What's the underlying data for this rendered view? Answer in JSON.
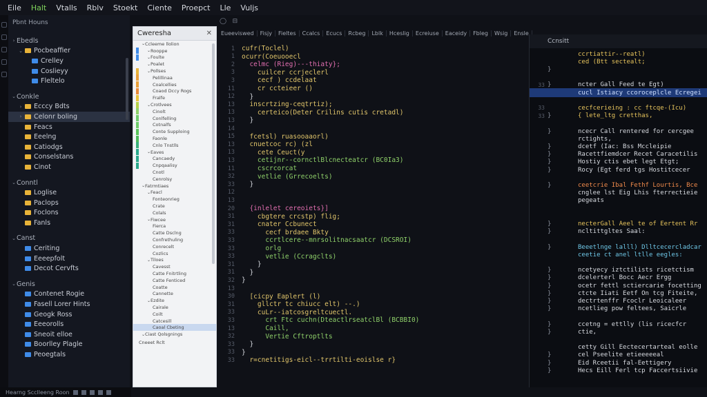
{
  "menu": [
    "Eile",
    "Halt",
    "Vtalls",
    "Rblv",
    "Stoekt",
    "Ciente",
    "Proepct",
    "Lle",
    "Vuljs"
  ],
  "sidebar": {
    "title": "Pbnt Houns",
    "rows": [
      {
        "text": "Ebedls",
        "depth": 0,
        "chev": "›",
        "icon": "none",
        "section": true
      },
      {
        "text": "Pocbeaffier",
        "depth": 1,
        "chev": "⌄",
        "icon": "folder"
      },
      {
        "text": "Crelley",
        "depth": 2,
        "chev": "",
        "icon": "folder-blue"
      },
      {
        "text": "Coslieyy",
        "depth": 2,
        "chev": "",
        "icon": "folder-blue"
      },
      {
        "text": "Fleltelo",
        "depth": 2,
        "chev": "",
        "icon": "folder-blue"
      },
      {
        "text": "Conkle",
        "depth": 0,
        "chev": "⌄",
        "icon": "none",
        "section": true
      },
      {
        "text": "Ecccy Bdts",
        "depth": 1,
        "chev": "›",
        "icon": "folder"
      },
      {
        "text": "Celonr boling",
        "depth": 1,
        "chev": "›",
        "icon": "folder",
        "selected": true
      },
      {
        "text": "Feacs",
        "depth": 1,
        "chev": "",
        "icon": "folder"
      },
      {
        "text": "Eeelng",
        "depth": 1,
        "chev": "",
        "icon": "folder"
      },
      {
        "text": "Catiodgs",
        "depth": 1,
        "chev": "",
        "icon": "folder"
      },
      {
        "text": "Conselstans",
        "depth": 1,
        "chev": "",
        "icon": "folder"
      },
      {
        "text": "Cinot",
        "depth": 1,
        "chev": "",
        "icon": "folder"
      },
      {
        "text": "Conntl",
        "depth": 0,
        "chev": "⌄",
        "icon": "none",
        "section": true
      },
      {
        "text": "Loglise",
        "depth": 1,
        "chev": "",
        "icon": "folder"
      },
      {
        "text": "Paclops",
        "depth": 1,
        "chev": "",
        "icon": "folder"
      },
      {
        "text": "Foclons",
        "depth": 1,
        "chev": "",
        "icon": "folder"
      },
      {
        "text": "Fanls",
        "depth": 1,
        "chev": "",
        "icon": "folder"
      },
      {
        "text": "Canst",
        "depth": 0,
        "chev": "⌄",
        "icon": "none",
        "section": true
      },
      {
        "text": "Ceriting",
        "depth": 1,
        "chev": "",
        "icon": "folder-blue"
      },
      {
        "text": "Eeeepfolt",
        "depth": 1,
        "chev": "",
        "icon": "folder-blue"
      },
      {
        "text": "Decot Cervfts",
        "depth": 1,
        "chev": "",
        "icon": "folder-blue"
      },
      {
        "text": "Genis",
        "depth": 0,
        "chev": "⌄",
        "icon": "none",
        "section": true
      },
      {
        "text": "Contenet Rogie",
        "depth": 1,
        "chev": "",
        "icon": "folder-blue"
      },
      {
        "text": "Fasell Lorer Hints",
        "depth": 1,
        "chev": "",
        "icon": "folder-blue"
      },
      {
        "text": "Geogk Ross",
        "depth": 1,
        "chev": "",
        "icon": "folder-blue"
      },
      {
        "text": "Eeeorolls",
        "depth": 1,
        "chev": "",
        "icon": "folder-blue"
      },
      {
        "text": "Sneoit elloe",
        "depth": 1,
        "chev": "",
        "icon": "folder-blue"
      },
      {
        "text": "Boorlley Plagle",
        "depth": 1,
        "chev": "",
        "icon": "folder-blue"
      },
      {
        "text": "Peoegtals",
        "depth": 1,
        "chev": "",
        "icon": "folder-blue"
      }
    ]
  },
  "status": {
    "text": "Hearng Scclleeng Roon"
  },
  "outline": {
    "title": "Cweresha",
    "close": "✕",
    "rows": [
      {
        "text": "Ccleeme llolion",
        "depth": 0,
        "mark": ""
      },
      {
        "text": "Rooppe",
        "depth": 1,
        "mark": "#3f8be8"
      },
      {
        "text": "Foulte",
        "depth": 1,
        "mark": "#3f8be8"
      },
      {
        "text": "Poalet",
        "depth": 1,
        "mark": ""
      },
      {
        "text": "Pollses",
        "depth": 1,
        "mark": "#e8b339"
      },
      {
        "text": "Pelillinaa",
        "depth": 2,
        "mark": "#e8a039"
      },
      {
        "text": "Coalcellies",
        "depth": 2,
        "mark": "#e8a039"
      },
      {
        "text": "Coaod Dccy Rogs",
        "depth": 2,
        "mark": "#e88a39"
      },
      {
        "text": "Fralfe",
        "depth": 2,
        "mark": "#e8c339"
      },
      {
        "text": "Crotlvees",
        "depth": 1,
        "mark": "#b6d14a"
      },
      {
        "text": "Cinolt",
        "depth": 2,
        "mark": "#8fd16a"
      },
      {
        "text": "Conlfelling",
        "depth": 2,
        "mark": "#6fcc6a"
      },
      {
        "text": "Cotnalfs",
        "depth": 2,
        "mark": "#6fcc6a"
      },
      {
        "text": "Conte Supploing",
        "depth": 2,
        "mark": "#5ac45a"
      },
      {
        "text": "Faonle",
        "depth": 2,
        "mark": "#4cba5a"
      },
      {
        "text": "Cnlo Tnstlls",
        "depth": 2,
        "mark": "#3ab07a"
      },
      {
        "text": "Eaves",
        "depth": 1,
        "mark": "#2aa88a"
      },
      {
        "text": "Cancaedy",
        "depth": 2,
        "mark": "#2aa88a"
      },
      {
        "text": "Cnpqaalisy",
        "depth": 2,
        "mark": "#2aa88a"
      },
      {
        "text": "Cnotl",
        "depth": 2,
        "mark": ""
      },
      {
        "text": "Cenrolsy",
        "depth": 2,
        "mark": ""
      },
      {
        "text": "Fatrmtiaes",
        "depth": 0,
        "mark": ""
      },
      {
        "text": "Feacl",
        "depth": 1,
        "mark": ""
      },
      {
        "text": "Fonteonrieg",
        "depth": 2,
        "mark": ""
      },
      {
        "text": "Crate",
        "depth": 2,
        "mark": ""
      },
      {
        "text": "Colals",
        "depth": 2,
        "mark": ""
      },
      {
        "text": "Fiwcee",
        "depth": 1,
        "mark": ""
      },
      {
        "text": "Fierca",
        "depth": 2,
        "mark": ""
      },
      {
        "text": "Catte Dsclng",
        "depth": 2,
        "mark": ""
      },
      {
        "text": "Confrethuling",
        "depth": 2,
        "mark": ""
      },
      {
        "text": "Conrecelt",
        "depth": 2,
        "mark": ""
      },
      {
        "text": "Cozlics",
        "depth": 2,
        "mark": ""
      },
      {
        "text": "Tiloes",
        "depth": 1,
        "mark": ""
      },
      {
        "text": "Cavesst",
        "depth": 2,
        "mark": ""
      },
      {
        "text": "Catte Fnitrtling",
        "depth": 2,
        "mark": ""
      },
      {
        "text": "Catte Fenticed",
        "depth": 2,
        "mark": ""
      },
      {
        "text": "Coatte",
        "depth": 2,
        "mark": ""
      },
      {
        "text": "Cannette",
        "depth": 2,
        "mark": ""
      },
      {
        "text": "Ezdite",
        "depth": 1,
        "mark": ""
      },
      {
        "text": "Cairale",
        "depth": 2,
        "mark": ""
      },
      {
        "text": "Coilt",
        "depth": 2,
        "mark": ""
      },
      {
        "text": "Catcesill",
        "depth": 2,
        "mark": ""
      },
      {
        "text": "Caoal Cbeting",
        "depth": 2,
        "mark": "",
        "selected": true
      },
      {
        "text": "Ciast Qolsgnings",
        "depth": 0,
        "mark": ""
      }
    ],
    "footer": "Cneeet Rclt"
  },
  "tabs": [
    "Eueeviswed",
    "Fisjy",
    "Fieltes",
    "Ccalcs",
    "Ecucs",
    "Rcbeg",
    "Lblk",
    "Hceslig",
    "Ecreiuse",
    "Eaceidy",
    "Fbleg",
    "Wsig",
    "Ensle"
  ],
  "editor": {
    "lines": [
      {
        "n": "1",
        "t": "cufr(Toclel)",
        "c": "code"
      },
      {
        "n": "1",
        "t": "ocurr(Coeuooecl",
        "c": "code"
      },
      {
        "n": "2",
        "t": "  celmc (Rieg)---thiaty};",
        "c": "code kw"
      },
      {
        "n": "3",
        "t": "    cuilcer ccrjeclerl",
        "c": "code"
      },
      {
        "n": "3",
        "t": "    cecf ) ccdelaat",
        "c": "code"
      },
      {
        "n": "11",
        "t": "    cr ccteieer ()",
        "c": "code"
      },
      {
        "n": "12",
        "t": "  }",
        "c": "code wh"
      },
      {
        "n": "13",
        "t": "  inscrtzing-ceqtrtiz);",
        "c": "code"
      },
      {
        "n": "13",
        "t": "    certeico(Deter Crilins cutis cretadl)",
        "c": "code"
      },
      {
        "n": "13",
        "t": "  }",
        "c": "code wh"
      },
      {
        "n": "14",
        "t": "",
        "c": "code"
      },
      {
        "n": "15",
        "t": "  fcetsl) ruasooaaorl)",
        "c": "code"
      },
      {
        "n": "13",
        "t": "  cnuetcoc rc) (zl",
        "c": "code"
      },
      {
        "n": "13",
        "t": "    cete Ceuct(y",
        "c": "code"
      },
      {
        "n": "13",
        "t": "    cetijnr--cornctlBlcnecteatcr (BC0Ia3)",
        "c": "code gr"
      },
      {
        "n": "11",
        "t": "    cscrcorcat",
        "c": "code gr"
      },
      {
        "n": "32",
        "t": "    vetlie (Grrecoelts)",
        "c": "code gr"
      },
      {
        "n": "33",
        "t": "  }",
        "c": "code wh"
      },
      {
        "n": "12",
        "t": "",
        "c": "code"
      },
      {
        "n": "13",
        "t": "",
        "c": "code"
      },
      {
        "n": "20",
        "t": "  {inlelet cereoiets}]",
        "c": "code kw"
      },
      {
        "n": "31",
        "t": "    cbgtere crcstp) flig;",
        "c": "code"
      },
      {
        "n": "31",
        "t": "    cnater Ccbunect",
        "c": "code"
      },
      {
        "n": "33",
        "t": "      cecf brdaee Bkty",
        "c": "code"
      },
      {
        "n": "33",
        "t": "      ccrtlcere--mnrsolitnacsaatcr (DCSROI)",
        "c": "code gr"
      },
      {
        "n": "33",
        "t": "      orlg",
        "c": "code gr"
      },
      {
        "n": "33",
        "t": "      vetlie (Ccragclts)",
        "c": "code gr"
      },
      {
        "n": "31",
        "t": "    }",
        "c": "code wh"
      },
      {
        "n": "31",
        "t": "  }",
        "c": "code wh"
      },
      {
        "n": "32",
        "t": "}",
        "c": "code wh"
      },
      {
        "n": "13",
        "t": "",
        "c": "code"
      },
      {
        "n": "30",
        "t": "  [cicpy Eaplert (l)",
        "c": "code"
      },
      {
        "n": "31",
        "t": "    gllctr tc chiucc elt) --.)",
        "c": "code"
      },
      {
        "n": "33",
        "t": "    cuLr--iatcosgreltcuectl.",
        "c": "code"
      },
      {
        "n": "33",
        "t": "      crt Ftc cuchn(DteactlrseatclBl (BCBBI0)",
        "c": "code gr"
      },
      {
        "n": "13",
        "t": "      Caill,",
        "c": "code gr"
      },
      {
        "n": "32",
        "t": "      Vertie Cftroptlts",
        "c": "code gr"
      },
      {
        "n": "33",
        "t": "  }",
        "c": "code wh"
      },
      {
        "n": "33",
        "t": "}",
        "c": "code wh"
      },
      {
        "n": "33",
        "t": "  r=cnetitigs-eicl--trrtilti-eoislse r}",
        "c": "code"
      }
    ]
  },
  "rightpanel": {
    "title": "Ccnsitt",
    "lines": [
      {
        "n": "",
        "m": "",
        "t": "ccrtiattir--reatl)",
        "c": "yl"
      },
      {
        "n": "",
        "m": "",
        "t": "ced (Btt sectealt;",
        "c": "yl"
      },
      {
        "n": "",
        "m": "}",
        "t": "",
        "c": ""
      },
      {
        "n": "",
        "m": "",
        "t": "",
        "c": ""
      },
      {
        "n": "33",
        "m": "}",
        "t": "ncter Gall Feed te Egt)",
        "c": ""
      },
      {
        "n": "",
        "m": "",
        "t": "cucl Istiacy ccoroceplcle Ecregei",
        "c": "cy",
        "sel": true
      },
      {
        "n": "",
        "m": "",
        "t": "",
        "c": ""
      },
      {
        "n": "33",
        "m": "",
        "t": "cecfcerieing : cc ftcqe-(Icu)",
        "c": "yl"
      },
      {
        "n": "33",
        "m": "}",
        "t": "{ lete_ltg cretthas,",
        "c": "yl"
      },
      {
        "n": "",
        "m": "",
        "t": "",
        "c": ""
      },
      {
        "n": "",
        "m": "}",
        "t": "ncecr Call rentered for cercgee",
        "c": ""
      },
      {
        "n": "",
        "m": "",
        "t": "rctights,",
        "c": ""
      },
      {
        "n": "",
        "m": "}",
        "t": "dcetf (Iac: Bss Mccleipie",
        "c": ""
      },
      {
        "n": "",
        "m": "}",
        "t": "Racettfiemdcer Recet Caracetilis",
        "c": ""
      },
      {
        "n": "",
        "m": "}",
        "t": "Hostiy ctis ebet legt Etgt;",
        "c": ""
      },
      {
        "n": "",
        "m": "}",
        "t": "Rocy (Egt ferd tgs Hostitcecer",
        "c": ""
      },
      {
        "n": "",
        "m": "",
        "t": "",
        "c": ""
      },
      {
        "n": "",
        "m": "}",
        "t": "ceetcrie Ibal Fethf Lourtis, Bce",
        "c": "or"
      },
      {
        "n": "",
        "m": "",
        "t": "cnglee lst Eig Lhis fterrectieie",
        "c": ""
      },
      {
        "n": "",
        "m": "",
        "t": "pegeats",
        "c": ""
      },
      {
        "n": "",
        "m": "",
        "t": "",
        "c": ""
      },
      {
        "n": "",
        "m": "",
        "t": "",
        "c": ""
      },
      {
        "n": "",
        "m": "}",
        "t": "necterGall Aeel te of Eertent Rr",
        "c": "yl"
      },
      {
        "n": "",
        "m": "}",
        "t": "ncltittgltes Saal:",
        "c": ""
      },
      {
        "n": "",
        "m": "",
        "t": "",
        "c": ""
      },
      {
        "n": "",
        "m": "}",
        "t": "Beeetlnge lalll) Dlltcecercladcar",
        "c": "cy"
      },
      {
        "n": "",
        "m": "",
        "t": "ceetie ct anel ltlle eegles:",
        "c": "cy"
      },
      {
        "n": "",
        "m": "",
        "t": "",
        "c": ""
      },
      {
        "n": "",
        "m": "}",
        "t": "ncetyecy iztctilists ricetctism",
        "c": ""
      },
      {
        "n": "",
        "m": "}",
        "t": "dcelerterl Bocc Aecr Ergg",
        "c": ""
      },
      {
        "n": "",
        "m": "}",
        "t": "ocetr fettl sctiercarie focetting",
        "c": ""
      },
      {
        "n": "",
        "m": "}",
        "t": "ctcte Iiati Eetf On tcg Fiteite,",
        "c": ""
      },
      {
        "n": "",
        "m": "}",
        "t": "dectrtenffr Fcoclr Leoicaleer",
        "c": ""
      },
      {
        "n": "",
        "m": "}",
        "t": "ncetlieg pow feltees, Saicrle",
        "c": ""
      },
      {
        "n": "",
        "m": "",
        "t": "",
        "c": ""
      },
      {
        "n": "",
        "m": "}",
        "t": "ccetng = ettlly (lis ricecfcr",
        "c": ""
      },
      {
        "n": "",
        "m": "}",
        "t": "ctie,",
        "c": ""
      },
      {
        "n": "",
        "m": "",
        "t": "",
        "c": ""
      },
      {
        "n": "",
        "m": "",
        "t": "cetty Gill Eectecertarteal eolle",
        "c": ""
      },
      {
        "n": "",
        "m": "}",
        "t": "cel Pseelite etieeeeeal",
        "c": ""
      },
      {
        "n": "",
        "m": "}",
        "t": "Eid Rceetii fal-Eettigery",
        "c": ""
      },
      {
        "n": "",
        "m": "}",
        "t": "Hecs Eill Ferl tcp Faccertsiivie",
        "c": ""
      }
    ]
  }
}
